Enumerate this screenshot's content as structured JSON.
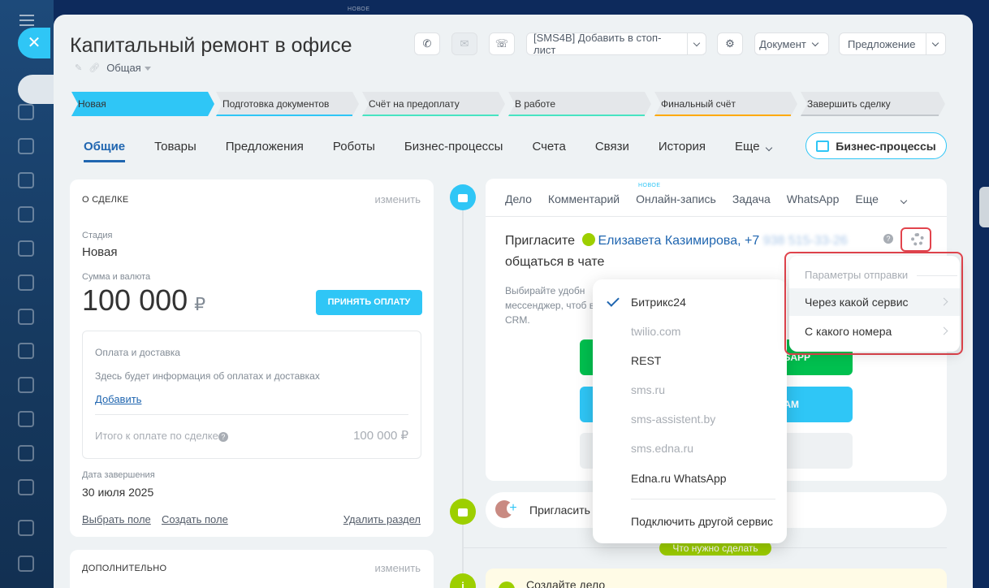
{
  "topbar": {
    "new_label": "НОВОЕ"
  },
  "header": {
    "title": "Капитальный ремонт в офисе",
    "category": "Общая",
    "sms_button": "[SMS4B] Добавить в стоп-лист",
    "document_button": "Документ",
    "offer_button": "Предложение"
  },
  "stages": [
    {
      "label": "Новая",
      "color": "#2fc6f6",
      "bar": "#2fc6f6"
    },
    {
      "label": "Подготовка документов",
      "color": "#e4e7ea",
      "bar": "#2fc6f6"
    },
    {
      "label": "Счёт на предоплату",
      "color": "#e4e7ea",
      "bar": "#47e4c2"
    },
    {
      "label": "В работе",
      "color": "#e4e7ea",
      "bar": "#47e4c2"
    },
    {
      "label": "Финальный счёт",
      "color": "#e4e7ea",
      "bar": "#ffa900"
    },
    {
      "label": "Завершить сделку",
      "color": "#e4e7ea",
      "bar": "#c3c8cd"
    }
  ],
  "tabs": [
    {
      "label": "Общие"
    },
    {
      "label": "Товары"
    },
    {
      "label": "Предложения"
    },
    {
      "label": "Роботы"
    },
    {
      "label": "Бизнес-процессы"
    },
    {
      "label": "Счета"
    },
    {
      "label": "Связи"
    },
    {
      "label": "История"
    },
    {
      "label": "Еще"
    }
  ],
  "bp_button": "Бизнес-процессы",
  "deal_card": {
    "heading": "О СДЕЛКЕ",
    "edit": "изменить",
    "stage_label": "Стадия",
    "stage_value": "Новая",
    "sum_label": "Сумма и валюта",
    "sum_value": "100 000",
    "currency": "₽",
    "pay_button": "ПРИНЯТЬ ОПЛАТУ",
    "payment_title": "Оплата и доставка",
    "payment_info": "Здесь будет информация об оплатах и доставках",
    "add_link": "Добавить",
    "total_label": "Итого к оплате по сделке",
    "total_value": "100 000 ₽",
    "close_label": "Дата завершения",
    "close_value": "30 июля 2025",
    "choose_field": "Выбрать поле",
    "create_field": "Создать поле",
    "delete_section": "Удалить раздел"
  },
  "extra_card": {
    "heading": "ДОПОЛНИТЕЛЬНО",
    "edit": "изменить"
  },
  "editor": {
    "tabs": [
      "Дело",
      "Комментарий",
      "Онлайн-запись",
      "Задача",
      "WhatsApp",
      "Еще"
    ],
    "new_badge": "НОВОЕ",
    "invite_prefix": "Пригласите",
    "contact": "Елизавета Казимирова, +7",
    "phone": "938 515-33-26",
    "invite_suffix": "общаться в чате",
    "desc": "Выбирайте удобн мессенджер, чтоб в CRM.",
    "btn_whatsapp": "SAPP",
    "btn_telegram": "GRAM"
  },
  "service_menu": {
    "items": [
      {
        "label": "Битрикс24",
        "enabled": true,
        "checked": true
      },
      {
        "label": "twilio.com",
        "enabled": false
      },
      {
        "label": "REST",
        "enabled": true
      },
      {
        "label": "sms.ru",
        "enabled": false
      },
      {
        "label": "sms-assistent.by",
        "enabled": false
      },
      {
        "label": "sms.edna.ru",
        "enabled": false
      },
      {
        "label": "Edna.ru WhatsApp",
        "enabled": true
      }
    ],
    "connect_other": "Подключить другой сервис"
  },
  "settings_popup": {
    "title": "Параметры отправки",
    "via_service": "Через какой сервис",
    "from_number": "С какого номера"
  },
  "timeline": {
    "invite_prefix": "Пригласить",
    "todo_badge": "Что нужно сделать",
    "create_task": "Создайте дело"
  }
}
